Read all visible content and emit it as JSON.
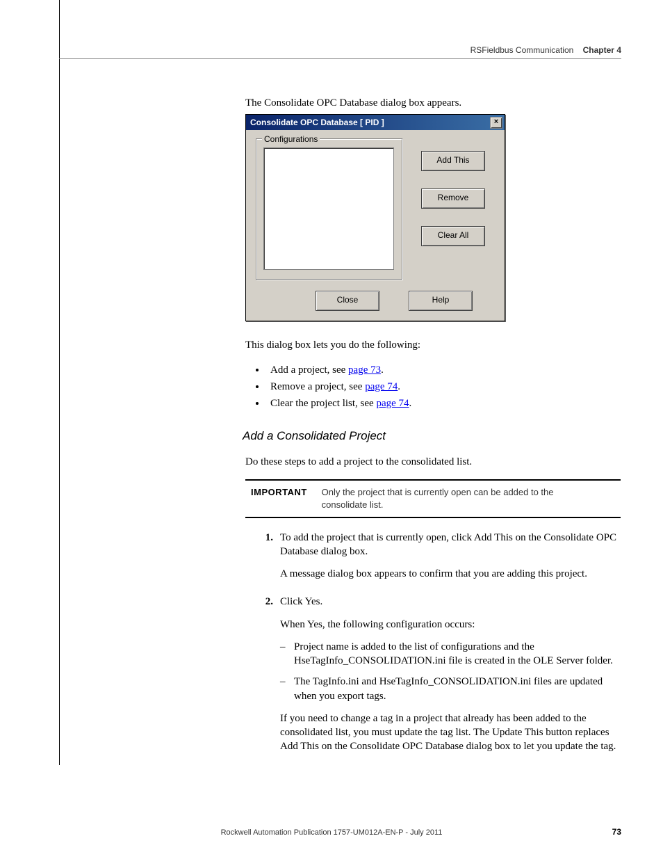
{
  "header": {
    "doc_section": "RSFieldbus Communication",
    "chapter": "Chapter 4"
  },
  "intro_line": "The Consolidate OPC Database dialog box appears.",
  "dialog": {
    "title": "Consolidate OPC Database [ PID ]",
    "group_label": "Configurations",
    "buttons": {
      "add": "Add This",
      "remove": "Remove",
      "clear": "Clear All",
      "close": "Close",
      "help": "Help"
    },
    "close_x": "×"
  },
  "after_dialog": "This dialog box lets you do the following:",
  "bullets": [
    {
      "pre": "Add a project, see ",
      "link": "page 73",
      "post": "."
    },
    {
      "pre": "Remove a project, see ",
      "link": "page 74",
      "post": "."
    },
    {
      "pre": "Clear the project list, see ",
      "link": "page 74",
      "post": "."
    }
  ],
  "section_heading": "Add a Consolidated Project",
  "section_intro": "Do these steps to add a project to the consolidated list.",
  "callout": {
    "tag": "IMPORTANT",
    "text": "Only the project that is currently open can be added to the consolidate list."
  },
  "steps": {
    "s1": {
      "num": "1.",
      "p1": "To add the project that is currently open, click Add This on the Consolidate OPC Database dialog box.",
      "p2": "A message dialog box appears to confirm that you are adding this project."
    },
    "s2": {
      "num": "2.",
      "p1": "Click Yes.",
      "p2": "When Yes, the following configuration occurs:",
      "d1": "Project name is added to the list of configurations and the HseTagInfo_CONSOLIDATION.ini file is created in the OLE Server folder.",
      "d2": "The TagInfo.ini and HseTagInfo_CONSOLIDATION.ini files are updated when you export tags.",
      "p3": "If you need to change a tag in a project that already has been added to the consolidated list, you must update the tag list. The Update This button replaces Add This on the Consolidate OPC Database dialog box to let you update the tag."
    }
  },
  "footer": "Rockwell Automation Publication 1757-UM012A-EN-P - July 2011",
  "page_number": "73"
}
